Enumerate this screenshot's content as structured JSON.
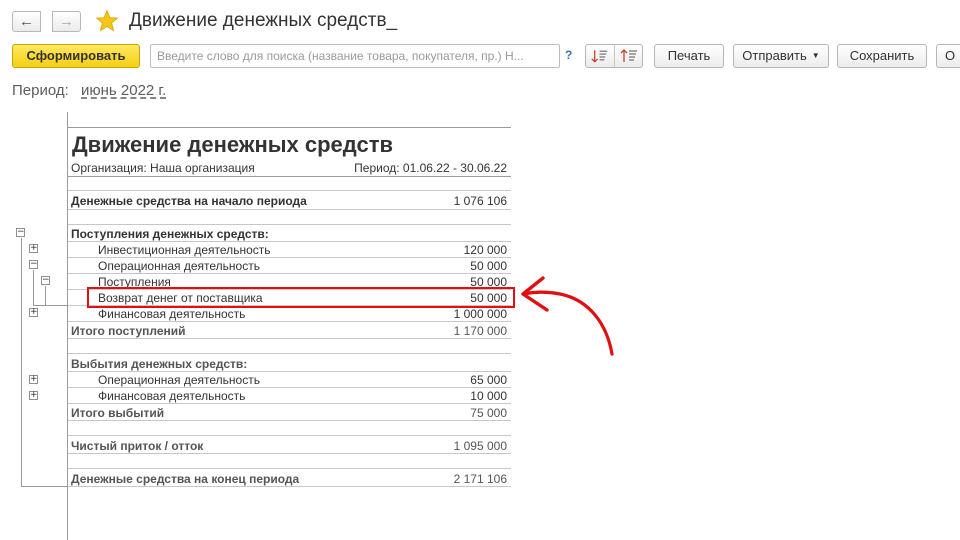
{
  "header": {
    "back_icon": "←",
    "forward_icon": "→",
    "title": "Движение денежных средств_"
  },
  "toolbar": {
    "generate_label": "Сформировать",
    "search_placeholder": "Введите слово для поиска (название товара, покупателя, пр.) Н...",
    "help_label": "?",
    "print_label": "Печать",
    "send_label": "Отправить",
    "save_label": "Сохранить",
    "more_label": "О"
  },
  "period": {
    "label": "Период:",
    "value": "июнь 2022 г."
  },
  "report": {
    "title": "Движение денежных средств",
    "organization": "Организация: Наша организация",
    "period": "Период: 01.06.22 - 30.06.22",
    "opening": {
      "label": "Денежные средства на начало периода",
      "value": "1 076 106"
    },
    "receipts_header": "Поступления денежных средств:",
    "receipts": [
      {
        "label": "Инвестиционная деятельность",
        "value": "120 000",
        "toggle": "+"
      },
      {
        "label": "Операционная деятельность",
        "value": "50 000",
        "toggle": "−"
      },
      {
        "label": "Поступления",
        "value": "50 000",
        "toggle": "−"
      },
      {
        "label": "Возврат денег от поставщика",
        "value": "50 000"
      },
      {
        "label": "Финансовая деятельность",
        "value": "1 000 000",
        "toggle": "+"
      }
    ],
    "receipts_total": {
      "label": "Итого поступлений",
      "value": "1 170 000"
    },
    "outflows_header": "Выбытия денежных средств:",
    "outflows": [
      {
        "label": "Операционная деятельность",
        "value": "65 000",
        "toggle": "+"
      },
      {
        "label": "Финансовая деятельность",
        "value": "10 000",
        "toggle": "+"
      }
    ],
    "outflows_total": {
      "label": "Итого выбытий",
      "value": "75 000"
    },
    "net": {
      "label": "Чистый приток / отток",
      "value": "1 095 000"
    },
    "closing": {
      "label": "Денежные средства на конец периода",
      "value": "2 171 106"
    },
    "root_toggle": "−"
  },
  "colors": {
    "accent_yellow": "#f5cf14",
    "highlight_red": "#e01010",
    "star": "#f5c518"
  }
}
